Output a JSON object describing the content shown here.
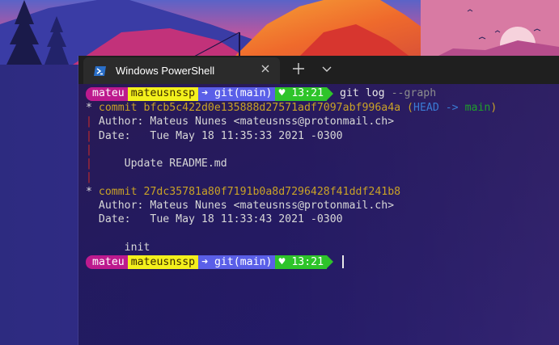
{
  "window": {
    "tab_title": "Windows PowerShell",
    "tab_icon": "powershell-icon",
    "close_icon": "close-icon",
    "new_tab_icon": "plus-icon",
    "dropdown_icon": "chevron-down-icon"
  },
  "prompt": {
    "user": "mateu",
    "host": "mateusnssp",
    "git": "➜ git(main)",
    "time": "♥ 13:21",
    "colors": {
      "user": "#bd1a8e",
      "host": "#f3f01c",
      "git": "#5a5fe8",
      "time": "#2ec42a"
    }
  },
  "command": {
    "name": "git log",
    "arg": "--graph"
  },
  "commits": [
    {
      "star": "*",
      "label": "commit",
      "hash": "bfcb5c422d0e135888d27571adf7097abf996a4a",
      "ref_open": "(",
      "ref_head": "HEAD",
      "ref_arrow": "->",
      "ref_branch": "main",
      "ref_close": ")",
      "author": "Author: Mateus Nunes <mateusnss@protonmail.ch>",
      "date": "Date:   Tue May 18 11:35:33 2021 -0300",
      "message": "Update README.md"
    },
    {
      "star": "*",
      "label": "commit",
      "hash": "27dc35781a80f7191b0a8d7296428f41ddf241b8",
      "author": "Author: Mateus Nunes <mateusnss@protonmail.ch>",
      "date": "Date:   Tue May 18 11:33:43 2021 -0300",
      "message": "init"
    }
  ],
  "graph_pipe": "|"
}
